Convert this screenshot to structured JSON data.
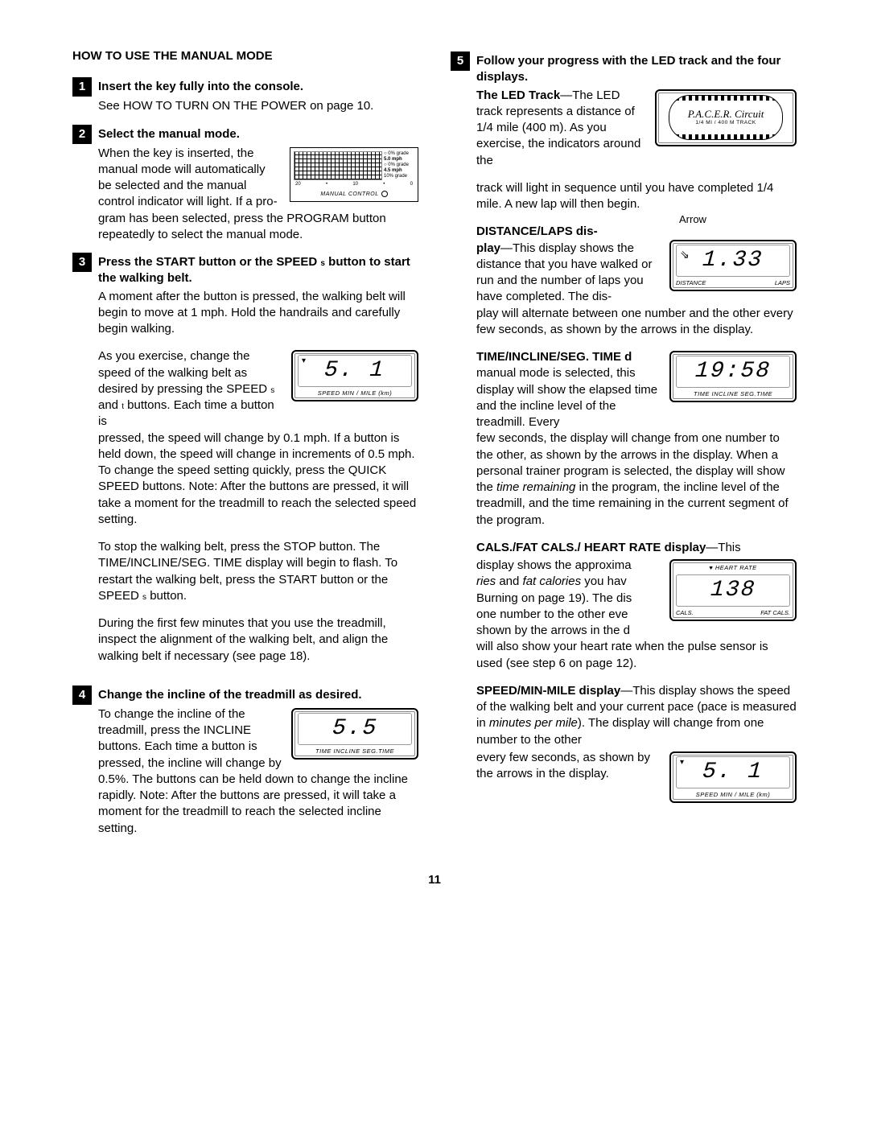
{
  "left": {
    "header": "HOW TO USE THE MANUAL MODE",
    "step1": {
      "num": "1",
      "title": "Insert the key fully into the console.",
      "body": "See HOW TO TURN ON THE POWER on page 10."
    },
    "step2": {
      "num": "2",
      "title": "Select the manual mode.",
      "p1": "When the key is inserted, the manual mode will automatically be selected and the manual control indicator will light. If a pro-",
      "p1b": "gram has been selected, press the PROGRAM button repeatedly to select the manual mode.",
      "panel": {
        "side1a": "0% grade",
        "side1b": "5.0 mph",
        "side2a": "0% grade",
        "side2b": "4.5 mph",
        "side3": "10% grade",
        "b1": "20",
        "b2": "•",
        "b3": "10",
        "b4": "•",
        "b5": "0",
        "label": "MANUAL CONTROL"
      }
    },
    "step3": {
      "num": "3",
      "title_a": "Press the START button or the SPEED ",
      "title_s": "s",
      "title_b": " button to start the walking belt.",
      "p1": "A moment after the button is pressed, the walking belt will begin to move at 1 mph. Hold the handrails and carefully begin walking.",
      "p2a": "As you exercise, change the speed of the walking belt as desired by pressing the SPEED ",
      "p2s1": "s",
      "p2mid": " and ",
      "p2s2": "t",
      "p2b": " buttons. Each time a button is",
      "p2c": "pressed, the speed will change by 0.1 mph. If a button is held down, the speed will change in increments of 0.5 mph. To change the speed setting quickly, press the QUICK SPEED buttons. Note: After the buttons are pressed, it will take a moment for the treadmill to reach the selected speed setting.",
      "p3a": "To stop the walking belt, press the STOP button. The TIME/INCLINE/SEG. TIME display will begin to flash. To restart the walking belt, press the START button or the SPEED ",
      "p3s": "s",
      "p3b": " button.",
      "p4": "During the first few minutes that you use the treadmill, inspect the alignment of the walking belt, and align the walking belt if necessary (see page 18).",
      "lcd": {
        "value": "5. 1",
        "caption": "SPEED   MIN / MILE (km)"
      }
    },
    "step4": {
      "num": "4",
      "title": "Change the incline of the treadmill as desired.",
      "p1a": "To change the incline of the treadmill, press the INCLINE buttons. Each time a button is pressed, the incline will change by 0.5%. The buttons can be held",
      "p1b": "down to change the incline rapidly. Note: After the buttons are pressed, it will take a moment for the treadmill to reach the selected incline setting.",
      "lcd": {
        "value": "5.5",
        "caption": "TIME  INCLINE  SEG.TIME"
      }
    }
  },
  "right": {
    "step5": {
      "num": "5",
      "title": "Follow your progress with the LED track and the four displays.",
      "ledtrack": {
        "bold": "The LED Track",
        "p1a": "—The LED track represents a distance of 1/4 mile (400 m). As you exercise, the indicators around the",
        "p1b": "track will light in sequence until you have completed 1/4 mile. A new lap will then begin.",
        "track_title": "P.A.C.E.R. Circuit",
        "track_sub": "1/4 MI  /  400 M TRACK"
      },
      "distance": {
        "bold": "DISTANCE/LAPS dis-",
        "bold2": "play",
        "p1a": "—This display shows the distance that you have walked or run and the number of laps you have completed. The dis-",
        "p1b": "play will alternate between one number and the other every few seconds, as shown by the arrows in the display.",
        "arrow_label": "Arrow",
        "lcd": {
          "value": "1.33",
          "cap_l": "DISTANCE",
          "cap_r": "LAPS"
        }
      },
      "time": {
        "bold": "TIME/INCLINE/SEG. TIME d",
        "p1a": "manual mode is selected, this display will show the elapsed time and the incline level of the treadmill. Every",
        "p1b_a": "few seconds, the display will change from one number to the other, as shown by the arrows in the display. When a personal trainer program is selected, the display will show the ",
        "p1b_i": "time remaining",
        "p1b_b": " in the program, the incline level of the treadmill, and the time remaining in the current segment of the program.",
        "lcd": {
          "value": "19:58",
          "caption": "TIME  INCLINE  SEG.TIME"
        }
      },
      "cals": {
        "bold": "CALS./FAT CALS./ HEART RATE display",
        "lead": "—This",
        "p1a_a": "display shows the approxima",
        "p1a_i1": "ries",
        "p1a_mid": " and ",
        "p1a_i2": "fat calories",
        "p1a_b": " you hav",
        "p1a_c": "Burning on page 19). The dis",
        "p1a_d": "one number to the other eve",
        "p1a_e": "shown by the arrows in the d",
        "p1b": "will also show your heart rate when the pulse sensor is used (see step 6 on page 12).",
        "lcd": {
          "top": "♥ HEART RATE",
          "value": "138",
          "cap_l": "CALS.",
          "cap_r": "FAT CALS."
        }
      },
      "speed": {
        "bold": "SPEED/MIN-MILE display",
        "p1a_a": "—This display shows the speed of the walking belt and your current pace (pace is measured in ",
        "p1a_i": "minutes per mile",
        "p1a_b": "). The display will change from one number to the other",
        "p1b": "every few seconds, as shown by the arrows in the display.",
        "lcd": {
          "value": "5. 1",
          "caption": "SPEED   MIN / MILE (km)"
        }
      }
    }
  },
  "page_number": "11"
}
